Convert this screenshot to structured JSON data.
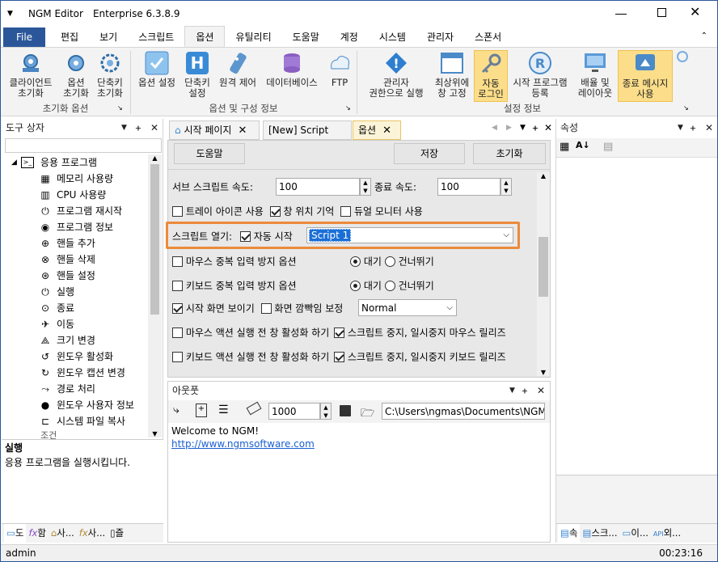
{
  "window": {
    "app_name": "NGM Editor",
    "edition": "Enterprise 6.3.8.9"
  },
  "ribbon_tabs": [
    "File",
    "편집",
    "보기",
    "스크립트",
    "옵션",
    "유틸리티",
    "도움말",
    "계정",
    "시스템",
    "관리자",
    "스폰서"
  ],
  "ribbon": {
    "groups": [
      "초기화 옵션",
      "옵션 및 구성 정보",
      "설정 정보"
    ],
    "init_buttons": [
      {
        "label1": "클라이언트",
        "label2": "초기화"
      },
      {
        "label1": "옵션",
        "label2": "초기화"
      },
      {
        "label1": "단축키",
        "label2": "초기화"
      }
    ],
    "config_buttons": [
      {
        "label1": "옵션 설정",
        "label2": ""
      },
      {
        "label1": "단축키",
        "label2": "설정"
      },
      {
        "label1": "원격 제어",
        "label2": ""
      },
      {
        "label1": "데이터베이스",
        "label2": ""
      },
      {
        "label1": "FTP",
        "label2": ""
      }
    ],
    "setting_buttons": [
      {
        "label1": "관리자",
        "label2": "권한으로 실행"
      },
      {
        "label1": "최상위에",
        "label2": "창 고정"
      },
      {
        "label1": "자동",
        "label2": "로그인"
      },
      {
        "label1": "시작 프로그램",
        "label2": "등록"
      },
      {
        "label1": "배율 및",
        "label2": "레이아웃"
      },
      {
        "label1": "종료 메시지",
        "label2": "사용"
      }
    ]
  },
  "toolbox": {
    "title": "도구 상자",
    "root": "응용 프로그램",
    "items": [
      "메모리 사용량",
      "CPU 사용량",
      "프로그램 재시작",
      "프로그램 정보",
      "핸들 추가",
      "핸들 삭제",
      "핸들 설정",
      "실행",
      "종료",
      "이동",
      "크기 변경",
      "윈도우 활성화",
      "윈도우 캡션 변경",
      "경로 처리",
      "윈도우 사용자 정보",
      "시스템 파일 복사"
    ],
    "next_root": "조건",
    "desc_title": "실행",
    "desc_text": "응용 프로그램을 실행시킵니다.",
    "bottom_tabs": [
      "도",
      "함",
      "사...",
      "사...",
      "즐"
    ]
  },
  "doc_tabs": [
    "시작 페이지",
    "[New] Script 1",
    "옵션"
  ],
  "options": {
    "help_btn": "도움말",
    "save_btn": "저장",
    "reset_btn": "초기화",
    "sub_speed_label": "서브 스크립트 속도:",
    "sub_speed_value": "100",
    "end_speed_label": "종료 속도:",
    "end_speed_value": "100",
    "tray_icon": "트레이 아이콘 사용",
    "remember_pos": "창 위치 기억",
    "dual_monitor": "듀얼 모니터 사용",
    "script_open_label": "스크립트 열기:",
    "auto_start": "자동 시작",
    "script_select": "Script 1",
    "mouse_dup": "마우스 중복 입력 방지 옵션",
    "kbd_dup": "키보드 중복 입력 방지 옵션",
    "wait": "대기",
    "skip": "건너뛰기",
    "show_start": "시작 화면 보이기",
    "flash": "화면 깜빡임 보정",
    "flash_select": "Normal",
    "mouse_activate": "마우스 액션 실행 전 창 활성화 하기",
    "mouse_release": "스크립트 중지, 일시중지 마우스 릴리즈",
    "kbd_activate": "키보드 액션 실행 전 창 활성화 하기",
    "kbd_release": "스크립트 중지, 일시중지 키보드 릴리즈"
  },
  "output": {
    "title": "아웃풋",
    "max_lines": "1000",
    "path": "C:\\Users\\ngmas\\Documents\\NGM6\\",
    "line1": "Welcome to NGM!",
    "line2": "http://www.ngmsoftware.com"
  },
  "properties": {
    "title": "속성",
    "bottom_tabs": [
      "속",
      "스크...",
      "이...",
      "외..."
    ]
  },
  "status": {
    "user": "admin",
    "time": "00:23:16"
  },
  "colors": {
    "accent": "#2b579a",
    "highlight_border": "#ec8a3a",
    "selection": "#fcde8a"
  }
}
